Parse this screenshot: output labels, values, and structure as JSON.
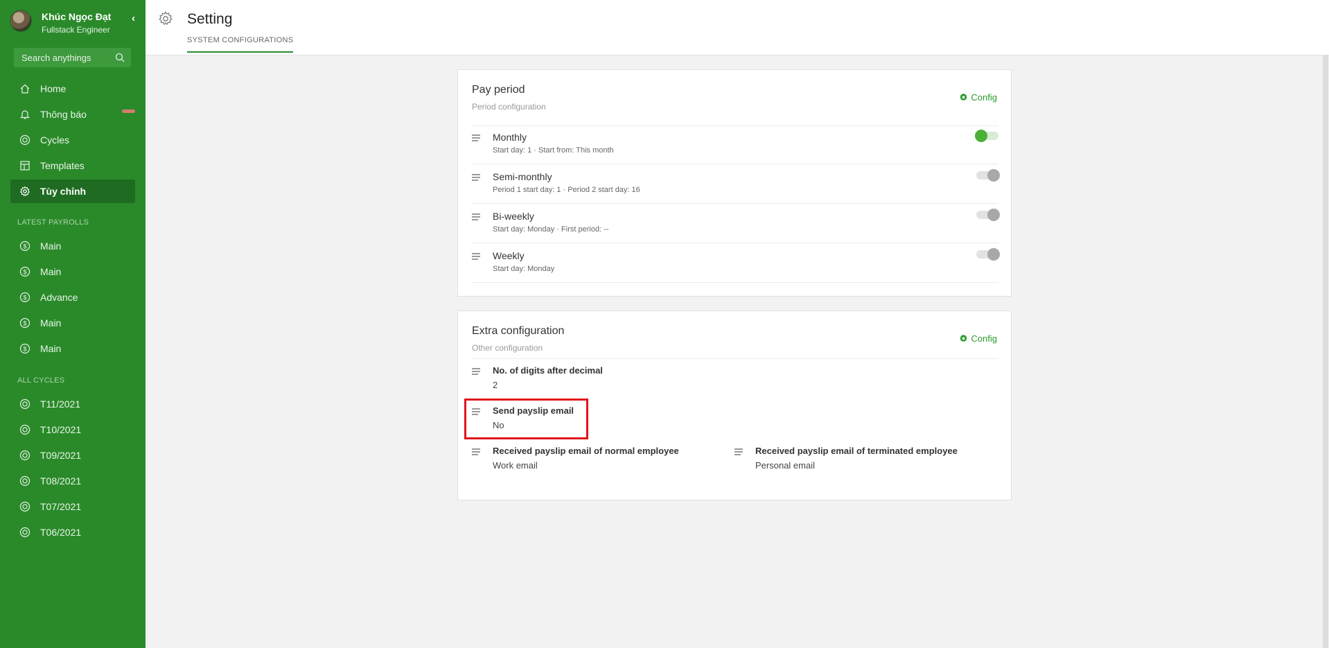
{
  "sidebar": {
    "user_name": "Khúc Ngọc Đạt",
    "user_role": "Fullstack Engineer",
    "collapse_icon": "chevron-left-icon",
    "search_placeholder": "Search anythings",
    "nav": [
      {
        "label": "Home",
        "icon": "home-icon"
      },
      {
        "label": "Thông báo",
        "icon": "bell-icon"
      },
      {
        "label": "Cycles",
        "icon": "cycle-icon"
      },
      {
        "label": "Templates",
        "icon": "templates-icon"
      },
      {
        "label": "Tùy chỉnh",
        "icon": "gear-icon",
        "active": true
      }
    ],
    "latest_payrolls_title": "LATEST PAYROLLS",
    "latest_payrolls": [
      "Main",
      "Main",
      "Advance",
      "Main",
      "Main"
    ],
    "all_cycles_title": "ALL CYCLES",
    "all_cycles": [
      "T11/2021",
      "T10/2021",
      "T09/2021",
      "T08/2021",
      "T07/2021",
      "T06/2021"
    ]
  },
  "header": {
    "title": "Setting",
    "tab": "SYSTEM CONFIGURATIONS"
  },
  "pay_period": {
    "title": "Pay period",
    "subtitle": "Period configuration",
    "config_label": "Config",
    "items": [
      {
        "name": "Monthly",
        "detail": "Start day: 1 · Start from: This month",
        "enabled": true
      },
      {
        "name": "Semi-monthly",
        "detail": "Period 1 start day: 1 · Period 2 start day: 16",
        "enabled": false
      },
      {
        "name": "Bi-weekly",
        "detail": "Start day: Monday · First period: --",
        "enabled": false
      },
      {
        "name": "Weekly",
        "detail": "Start day: Monday",
        "enabled": false
      }
    ]
  },
  "extra": {
    "title": "Extra configuration",
    "subtitle": "Other configuration",
    "config_label": "Config",
    "digits_label": "No. of digits after decimal",
    "digits_value": "2",
    "send_email_label": "Send payslip email",
    "send_email_value": "No",
    "normal_label": "Received payslip email of normal employee",
    "normal_value": "Work email",
    "terminated_label": "Received payslip email of terminated employee",
    "terminated_value": "Personal email"
  },
  "colors": {
    "sidebar_bg": "#2a8a2a",
    "active_item": "#1f6b22",
    "accent": "#2a9a2a",
    "highlight_box": "#e0141c"
  }
}
